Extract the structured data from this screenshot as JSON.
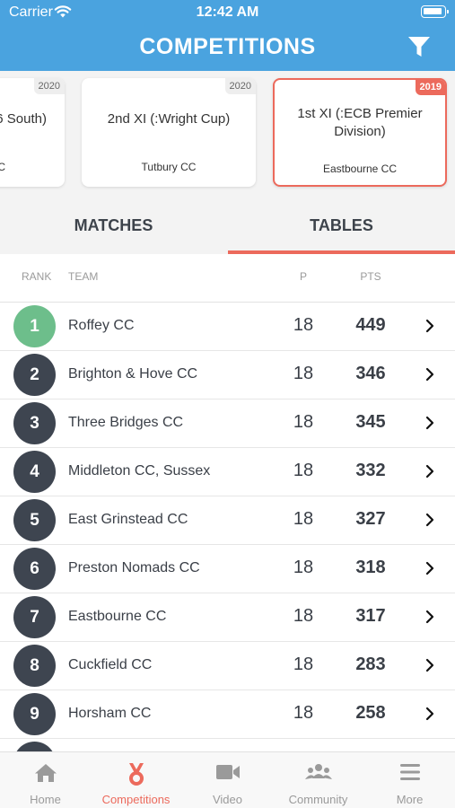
{
  "status_bar": {
    "carrier": "Carrier",
    "time": "12:42 AM"
  },
  "header": {
    "title": "COMPETITIONS",
    "filter_icon": "filter-icon"
  },
  "competitions": [
    {
      "year": "2020",
      "name": "6 South)",
      "club": "C",
      "selected": false
    },
    {
      "year": "2020",
      "name": "2nd XI (:Wright Cup)",
      "club": "Tutbury CC",
      "selected": false
    },
    {
      "year": "2019",
      "name": "1st XI (:ECB Premier Division)",
      "club": "Eastbourne CC",
      "selected": true
    }
  ],
  "tabs": [
    {
      "label": "MATCHES",
      "active": false
    },
    {
      "label": "TABLES",
      "active": true
    }
  ],
  "table": {
    "columns": {
      "rank": "RANK",
      "team": "TEAM",
      "played": "P",
      "points": "PTS"
    },
    "rows": [
      {
        "rank": "1",
        "team": "Roffey CC",
        "played": "18",
        "points": "449"
      },
      {
        "rank": "2",
        "team": "Brighton & Hove CC",
        "played": "18",
        "points": "346"
      },
      {
        "rank": "3",
        "team": "Three Bridges CC",
        "played": "18",
        "points": "345"
      },
      {
        "rank": "4",
        "team": "Middleton CC, Sussex",
        "played": "18",
        "points": "332"
      },
      {
        "rank": "5",
        "team": "East Grinstead CC",
        "played": "18",
        "points": "327"
      },
      {
        "rank": "6",
        "team": "Preston Nomads CC",
        "played": "18",
        "points": "318"
      },
      {
        "rank": "7",
        "team": "Eastbourne CC",
        "played": "18",
        "points": "317"
      },
      {
        "rank": "8",
        "team": "Cuckfield CC",
        "played": "18",
        "points": "283"
      },
      {
        "rank": "9",
        "team": "Horsham CC",
        "played": "18",
        "points": "258"
      }
    ]
  },
  "tab_bar": [
    {
      "label": "Home",
      "icon": "home-icon",
      "active": false
    },
    {
      "label": "Competitions",
      "icon": "medal-icon",
      "active": true
    },
    {
      "label": "Video",
      "icon": "video-camera-icon",
      "active": false
    },
    {
      "label": "Community",
      "icon": "community-icon",
      "active": false
    },
    {
      "label": "More",
      "icon": "menu-icon",
      "active": false
    }
  ],
  "colors": {
    "header_blue": "#4aa3df",
    "accent_coral": "#ec6a5c",
    "rank_green": "#6dbe8b",
    "rank_dark": "#3e4550"
  }
}
